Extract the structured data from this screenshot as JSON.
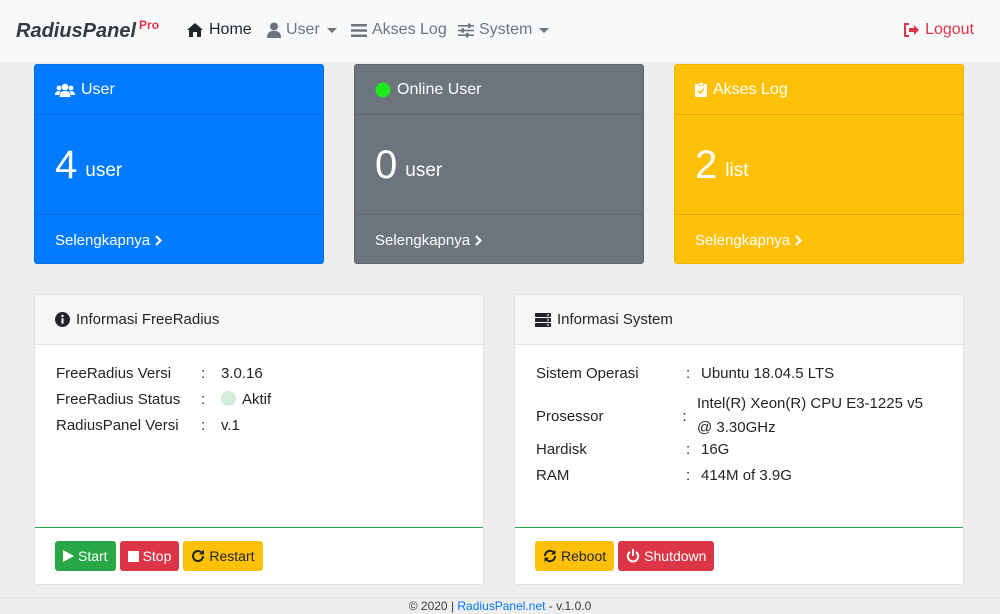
{
  "navbar": {
    "brand": "RadiusPanel",
    "brand_sup": "Pro",
    "items": [
      {
        "label": "Home",
        "icon": "home-icon"
      },
      {
        "label": "User",
        "icon": "user-icon"
      },
      {
        "label": "Akses Log",
        "icon": "list-icon"
      },
      {
        "label": "System",
        "icon": "sliders-icon"
      }
    ],
    "logout": "Logout"
  },
  "stats": [
    {
      "title": "User",
      "value": "4",
      "unit": "user",
      "link": "Selengkapnya",
      "color": "#007bff"
    },
    {
      "title": "Online User",
      "value": "0",
      "unit": "user",
      "link": "Selengkapnya",
      "color": "#6c757d"
    },
    {
      "title": "Akses Log",
      "value": "2",
      "unit": "list",
      "link": "Selengkapnya",
      "color": "#ffc107"
    }
  ],
  "freeradius": {
    "title": "Informasi FreeRadius",
    "rows": [
      {
        "key": "FreeRadius Versi",
        "value": "3.0.16"
      },
      {
        "key": "FreeRadius Status",
        "value": "Aktif"
      },
      {
        "key": "RadiusPanel Versi",
        "value": "v.1"
      }
    ],
    "buttons": {
      "start": "Start",
      "stop": "Stop",
      "restart": "Restart"
    }
  },
  "system": {
    "title": "Informasi System",
    "rows": [
      {
        "key": "Sistem Operasi",
        "value": "Ubuntu 18.04.5 LTS"
      },
      {
        "key": "Prosessor",
        "value": "Intel(R) Xeon(R) CPU E3-1225 v5 @ 3.30GHz"
      },
      {
        "key": "Hardisk",
        "value": "16G"
      },
      {
        "key": "RAM",
        "value": "414M of 3.9G"
      }
    ],
    "buttons": {
      "reboot": "Reboot",
      "shutdown": "Shutdown"
    }
  },
  "colon": ":",
  "footer": {
    "prefix": "© 2020 | ",
    "link": "RadiusPanel.net",
    "suffix": " - v.1.0.0"
  }
}
